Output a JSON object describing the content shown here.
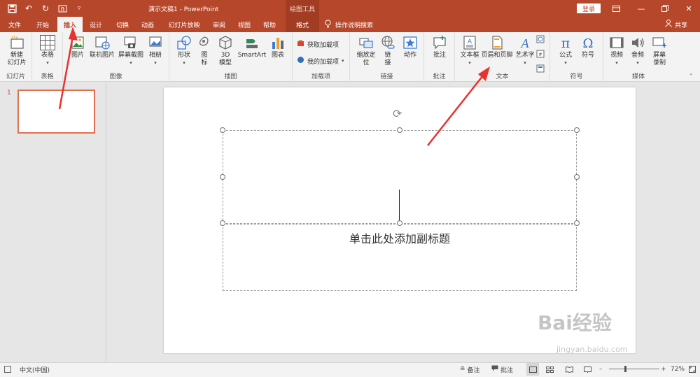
{
  "titlebar": {
    "document_title": "演示文稿1 - PowerPoint",
    "context_tool": "绘图工具",
    "login_label": "登录",
    "qat_icons": [
      "save-icon",
      "undo-icon",
      "redo-icon",
      "touch-mode-icon",
      "customize-icon"
    ]
  },
  "tabs": [
    {
      "label": "文件"
    },
    {
      "label": "开始"
    },
    {
      "label": "插入"
    },
    {
      "label": "设计"
    },
    {
      "label": "切换"
    },
    {
      "label": "动画"
    },
    {
      "label": "幻灯片放映"
    },
    {
      "label": "审阅"
    },
    {
      "label": "视图"
    },
    {
      "label": "帮助"
    },
    {
      "label": "格式"
    }
  ],
  "tellme": "操作说明搜索",
  "share": "共享",
  "ribbon": {
    "slides_group": {
      "label": "幻灯片",
      "new_slide": "新建\n幻灯片"
    },
    "tables_group": {
      "label": "表格",
      "table": "表格"
    },
    "images_group": {
      "label": "图像",
      "picture": "图片",
      "online_picture": "联机图片",
      "screenshot": "屏幕截图",
      "album": "相册"
    },
    "illustrations_group": {
      "label": "插图",
      "shapes": "形状",
      "icons": "图\n标",
      "model3d": "3D\n模型",
      "smartart": "SmartArt",
      "chart": "图表"
    },
    "addins_group": {
      "label": "加载项",
      "get_addins": "获取加载项",
      "my_addins": "我的加载项"
    },
    "links_group": {
      "label": "链接",
      "zoom": "缩放定\n位",
      "link": "链\n接",
      "action": "动作"
    },
    "comments_group": {
      "label": "批注",
      "comment": "批注"
    },
    "text_group": {
      "label": "文本",
      "textbox": "文本框",
      "header_footer": "页眉和页脚",
      "wordart": "艺术字"
    },
    "symbols_group": {
      "label": "符号",
      "equation": "公式",
      "symbol": "符号"
    },
    "media_group": {
      "label": "媒体",
      "video": "视频",
      "audio": "音频",
      "screen_recording": "屏幕\n录制"
    }
  },
  "thumbnail": {
    "slide_number": "1"
  },
  "slide": {
    "subtitle_placeholder": "单击此处添加副标题"
  },
  "statusbar": {
    "language": "中文(中国)",
    "notes": "备注",
    "comments": "批注",
    "zoom": "72%"
  },
  "watermark": {
    "text": "Bai经验",
    "url": "jingyan.baidu.com"
  },
  "colors": {
    "accent": "#b7472a",
    "arrow": "#e8322e"
  }
}
